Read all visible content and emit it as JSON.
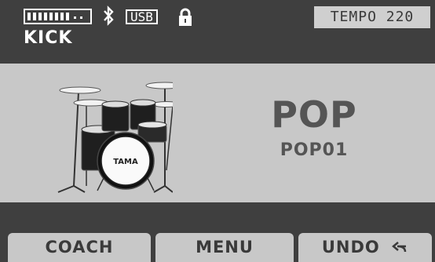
{
  "status": {
    "battery_icon": "battery-icon",
    "battery_level": 0.75,
    "bluetooth_icon": "bluetooth-icon",
    "usb_label": "USB",
    "lock_icon": "lock-icon",
    "instrument": "KICK",
    "tempo_label": "TEMPO 220"
  },
  "kit": {
    "image_icon": "drum-kit-icon",
    "image_brand": "TAMA",
    "name": "POP",
    "code": "POP01"
  },
  "softkeys": {
    "coach": "COACH",
    "menu": "MENU",
    "undo": "UNDO",
    "undo_icon": "undo-arrow-icon"
  },
  "colors": {
    "bar_bg": "#3f3f3f",
    "panel_bg": "#c8c8c8",
    "text_dark": "#555555",
    "text_light": "#ffffff"
  }
}
